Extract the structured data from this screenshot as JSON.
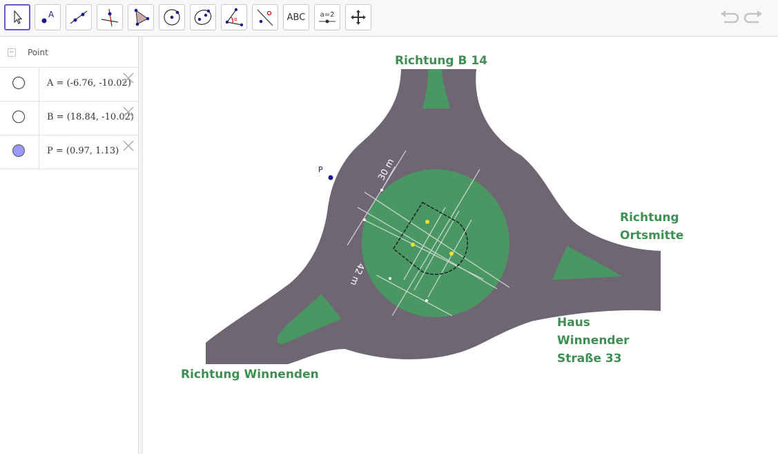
{
  "toolbar": {
    "tools": [
      {
        "name": "move-tool-icon"
      },
      {
        "name": "point-tool-icon"
      },
      {
        "name": "line-tool-icon"
      },
      {
        "name": "perpendicular-line-tool-icon"
      },
      {
        "name": "polygon-tool-icon"
      },
      {
        "name": "circle-center-point-tool-icon"
      },
      {
        "name": "ellipse-tool-icon"
      },
      {
        "name": "angle-tool-icon"
      },
      {
        "name": "reflect-tool-icon"
      },
      {
        "name": "text-tool",
        "label": "ABC"
      },
      {
        "name": "slider-tool",
        "label": "a=2"
      },
      {
        "name": "move-graphics-view-tool-icon"
      }
    ],
    "active_tool": "move-tool-icon",
    "text_tool_label": "ABC",
    "slider_tool_label": "a=2"
  },
  "algebra": {
    "group_label": "Point",
    "rows": [
      {
        "label": "A = (-6.76, -10.02)",
        "visible": false
      },
      {
        "label": "B = (18.84, -10.02)",
        "visible": false
      },
      {
        "label": "P = (0.97, 1.13)",
        "visible": true
      }
    ]
  },
  "graphics": {
    "point_label": "P",
    "map_labels": {
      "north": "Richtung B 14",
      "east_line1": "Richtung",
      "east_line2": "Ortsmitte",
      "house_line1": "Haus",
      "house_line2": "Winnender",
      "house_line3": "Straße 33",
      "west": "Richtung Winnenden",
      "dim_30": "30 m",
      "dim_42": "42 m"
    }
  },
  "colors": {
    "road": "#6e6673",
    "grass": "#4a9764",
    "label_green": "#3f8f54",
    "accent": "#6557d2",
    "point": "#1a1a8c"
  }
}
